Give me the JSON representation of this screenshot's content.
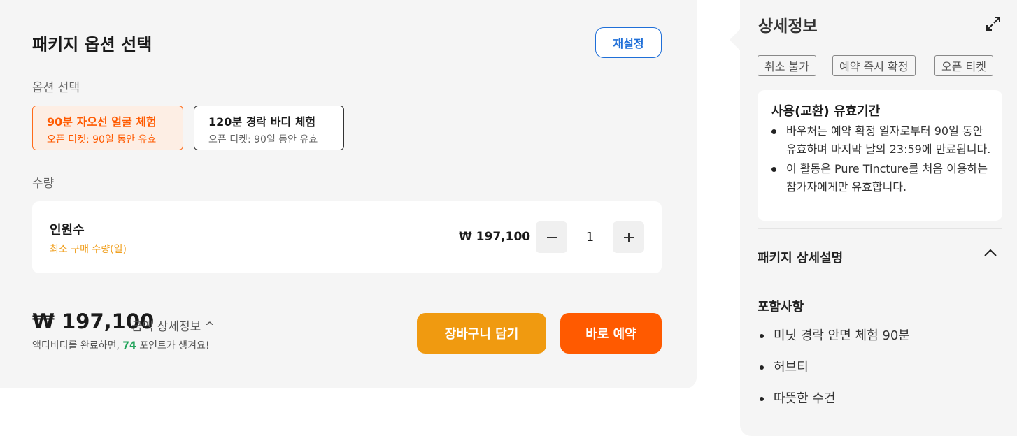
{
  "package": {
    "title": "패키지 옵션 선택",
    "reset_label": "재설정",
    "option_label": "옵션 선택",
    "options": [
      {
        "title": "90분 자오선 얼굴 체험",
        "sub": "오픈 티켓: 90일 동안 유효",
        "selected": true
      },
      {
        "title": "120분 경락 바디 체험",
        "sub": "오픈 티켓: 90일 동안 유효",
        "selected": false
      }
    ],
    "quantity_label": "수량",
    "quantity": {
      "name": "인원수",
      "min_note": "최소 구매 수량(일)",
      "price": "₩ 197,100",
      "value": "1"
    },
    "total": "₩ 197,100",
    "detail_link": "금액 상세정보 ^",
    "points_pre": "액티비티를 완료하면, ",
    "points_value": "74",
    "points_post": " 포인트가 생겨요!",
    "cart_label": "장바구니 담기",
    "book_label": "바로 예약"
  },
  "detail": {
    "title": "상세정보",
    "tags": [
      "취소 불가",
      "예약 즉시 확정",
      "오픈 티켓"
    ],
    "valid_title": "사용(교환) 유효기간",
    "valid_items": [
      "바우처는 예약 확정 일자로부터 90일 동안 유효하며 마지막 날의 23:59에 만료됩니다.",
      "이 활동은 Pure Tincture를 처음 이용하는 참가자에게만 유효합니다."
    ],
    "pkg_desc_title": "패키지 상세설명",
    "included_title": "포함사항",
    "included_items": [
      "미닛 경락 안면 체험 90분",
      "허브티",
      "따뜻한 수건"
    ]
  },
  "colors": {
    "accent_orange": "#ff5a00",
    "cart_orange": "#f09a10",
    "link_blue": "#1f6fd8",
    "points_green": "#21a35a"
  }
}
